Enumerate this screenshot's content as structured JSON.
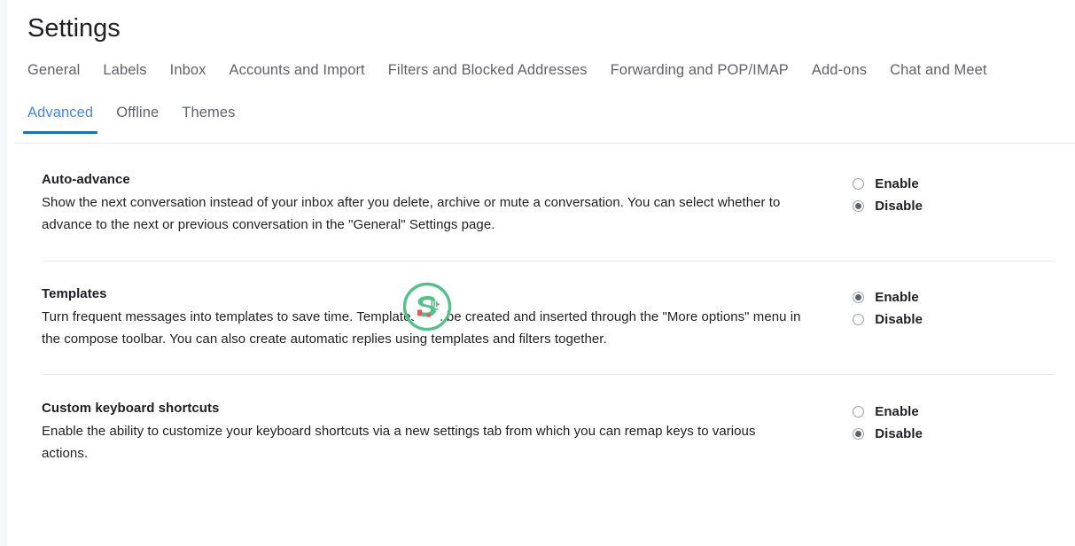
{
  "page": {
    "title": "Settings",
    "app": "gmail-settings"
  },
  "tabs": {
    "primary": [
      {
        "label": "General",
        "active": false
      },
      {
        "label": "Labels",
        "active": false
      },
      {
        "label": "Inbox",
        "active": false
      },
      {
        "label": "Accounts and Import",
        "active": false
      },
      {
        "label": "Filters and Blocked Addresses",
        "active": false
      },
      {
        "label": "Forwarding and POP/IMAP",
        "active": false
      },
      {
        "label": "Add-ons",
        "active": false
      },
      {
        "label": "Chat and Meet",
        "active": false
      }
    ],
    "secondary": [
      {
        "label": "Advanced",
        "active": true
      },
      {
        "label": "Offline",
        "active": false
      },
      {
        "label": "Themes",
        "active": false
      }
    ]
  },
  "sections": [
    {
      "id": "auto-advance",
      "title": "Auto-advance",
      "description": "Show the next conversation instead of your inbox after you delete, archive or mute a conversation. You can select whether to advance to the next or previous conversation in the \"General\" Settings page.",
      "options": [
        {
          "label": "Enable",
          "selected": false
        },
        {
          "label": "Disable",
          "selected": true
        }
      ]
    },
    {
      "id": "templates",
      "title": "Templates",
      "description": "Turn frequent messages into templates to save time. Templates can be created and inserted through the \"More options\" menu in the compose toolbar. You can also create automatic replies using templates and filters together.",
      "options": [
        {
          "label": "Enable",
          "selected": true
        },
        {
          "label": "Disable",
          "selected": false
        }
      ]
    },
    {
      "id": "custom-keyboard-shortcuts",
      "title": "Custom keyboard shortcuts",
      "description": "Enable the ability to customize your keyboard shortcuts via a new settings tab from which you can remap keys to various actions.",
      "options": [
        {
          "label": "Enable",
          "selected": false
        },
        {
          "label": "Disable",
          "selected": true
        }
      ]
    }
  ],
  "watermark": {
    "icon_name": "brand-logo-icon",
    "ring_color": "#54c08a",
    "glyph_color": "#54c08a",
    "accent_color": "#ef5350"
  },
  "colors": {
    "accent_tab_text": "#4285f4",
    "accent_tab_underline": "#1a6fc4",
    "text_primary": "#202124",
    "text_secondary": "#5f6368",
    "divider": "#e8eaed",
    "background": "#ffffff"
  }
}
